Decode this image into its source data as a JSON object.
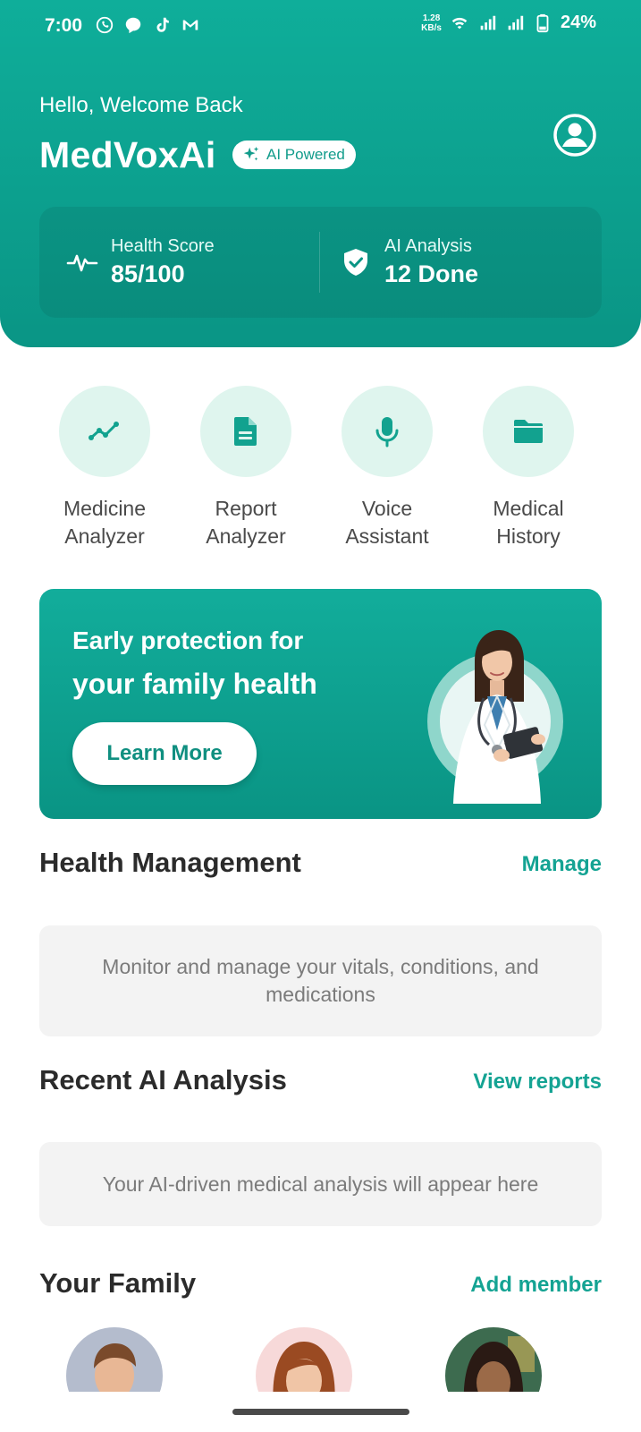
{
  "status_bar": {
    "time": "7:00",
    "net_speed_value": "1.28",
    "net_speed_unit": "KB/s",
    "battery": "24%",
    "left_icons": [
      "whatsapp-icon",
      "messenger-icon",
      "tiktok-icon",
      "mail-icon"
    ]
  },
  "header": {
    "greeting": "Hello, Welcome Back",
    "app_name": "MedVoxAi",
    "badge": "AI Powered"
  },
  "stats": [
    {
      "label": "Health Score",
      "value": "85/100",
      "icon": "heart-pulse-icon"
    },
    {
      "label": "AI Analysis",
      "value": "12 Done",
      "icon": "shield-check-icon"
    }
  ],
  "quick_actions": [
    {
      "line1": "Medicine",
      "line2": "Analyzer",
      "icon": "chart-line-icon"
    },
    {
      "line1": "Report",
      "line2": "Analyzer",
      "icon": "document-icon"
    },
    {
      "line1": "Voice",
      "line2": "Assistant",
      "icon": "microphone-icon"
    },
    {
      "line1": "Medical",
      "line2": "History",
      "icon": "folder-icon"
    }
  ],
  "banner": {
    "line1": "Early protection for",
    "line2": "your family health",
    "button": "Learn More"
  },
  "sections": {
    "health_management": {
      "title": "Health Management",
      "link": "Manage",
      "text": "Monitor and manage your vitals, conditions, and medications"
    },
    "recent_analysis": {
      "title": "Recent AI Analysis",
      "link": "View reports",
      "text": "Your AI-driven medical analysis will appear here"
    },
    "family": {
      "title": "Your Family",
      "link": "Add member"
    }
  },
  "colors": {
    "primary": "#0fae9a",
    "primary_dark": "#0a9585",
    "accent_text": "#14a393",
    "icon_circle": "#dff5ee",
    "info_box": "#f3f3f3"
  }
}
